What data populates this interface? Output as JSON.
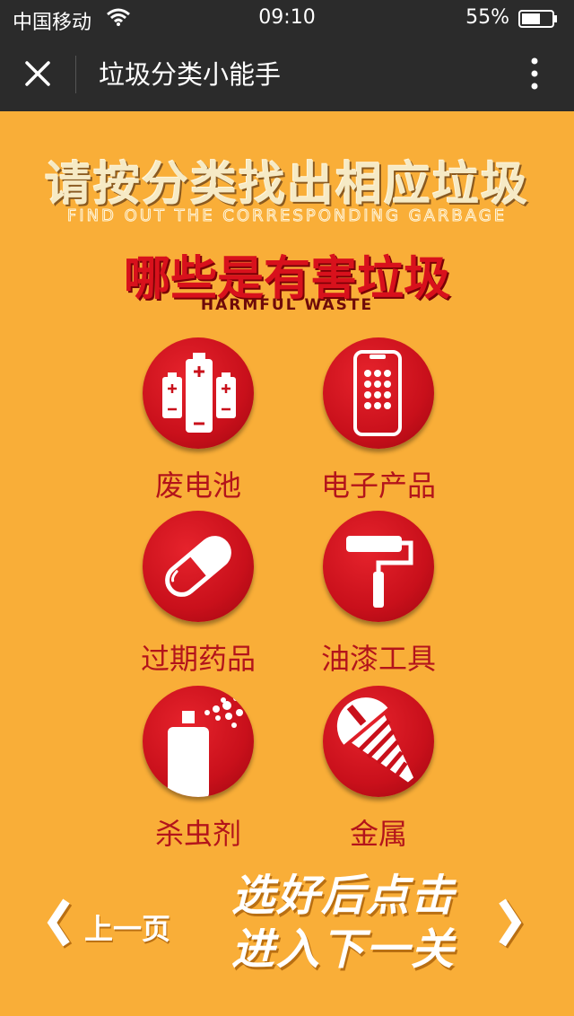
{
  "status": {
    "carrier": "中国移动",
    "time": "09:10",
    "battery": "55%"
  },
  "nav": {
    "title": "垃圾分类小能手"
  },
  "heading": {
    "title": "请按分类找出相应垃圾",
    "title_en": "FIND OUT THE CORRESPONDING GARBAGE",
    "category": "哪些是有害垃圾",
    "category_en": "HARMFUL WASTE"
  },
  "items": [
    {
      "label": "废电池",
      "icon": "battery-icon"
    },
    {
      "label": "电子产品",
      "icon": "phone-icon"
    },
    {
      "label": "过期药品",
      "icon": "pill-icon"
    },
    {
      "label": "油漆工具",
      "icon": "paint-roller-icon"
    },
    {
      "label": "杀虫剂",
      "icon": "spray-can-icon"
    },
    {
      "label": "金属",
      "icon": "screw-icon"
    }
  ],
  "footer": {
    "prev_label": "上一页",
    "cta_line1": "选好后点击",
    "cta_line2": "进入下一关"
  },
  "colors": {
    "background": "#f9ae38",
    "accent": "#d8111c",
    "bar": "#2b2b2b"
  }
}
